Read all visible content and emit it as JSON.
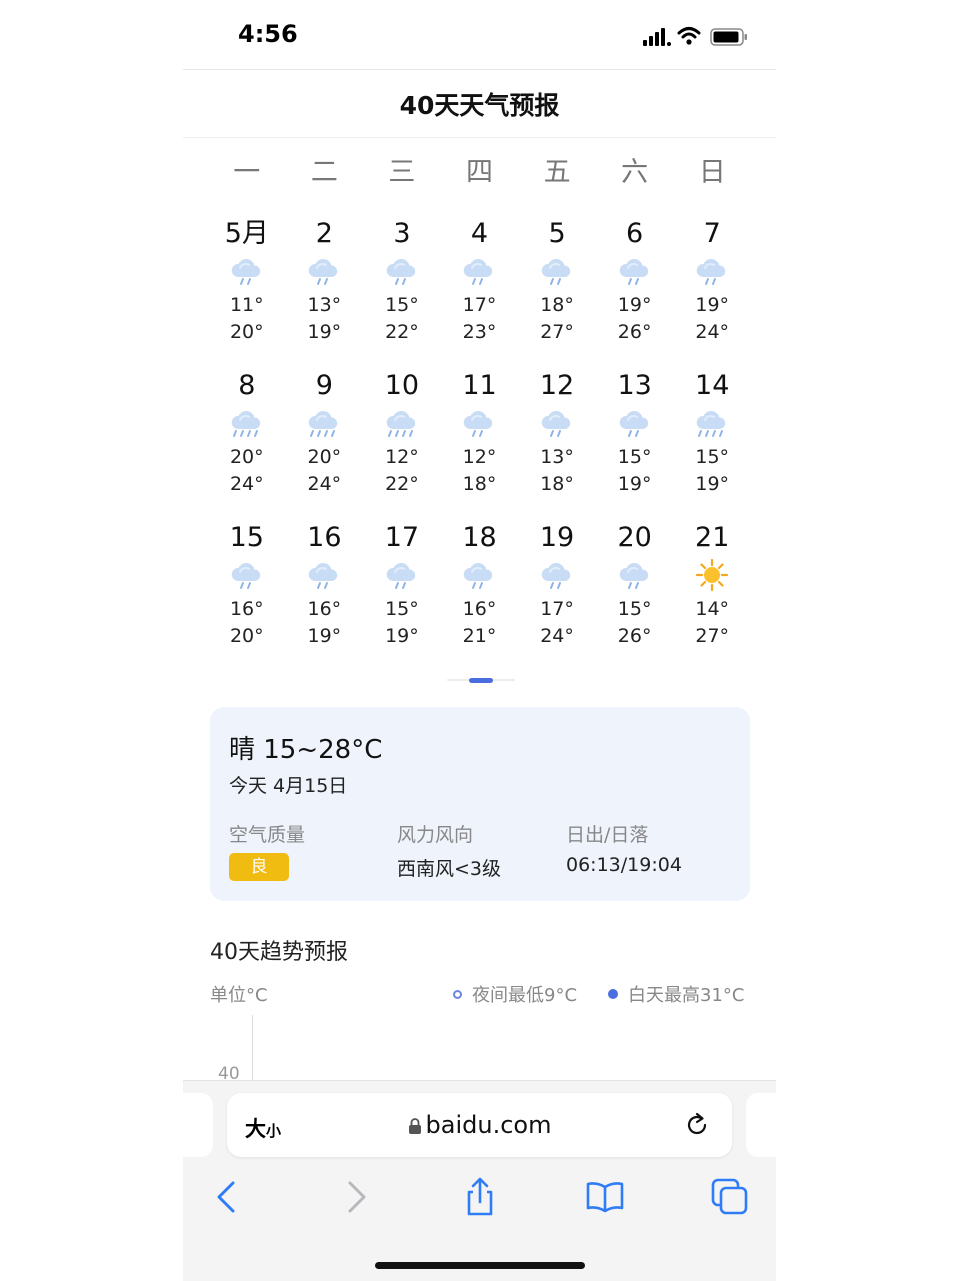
{
  "status": {
    "time": "4:56"
  },
  "page": {
    "title": "40天天气预报"
  },
  "weekdays": [
    "一",
    "二",
    "三",
    "四",
    "五",
    "六",
    "日"
  ],
  "calendar": [
    {
      "day": "5月",
      "icon": "rain-cloud-icon",
      "low": "11°",
      "high": "20°"
    },
    {
      "day": "2",
      "icon": "rain-cloud-icon",
      "low": "13°",
      "high": "19°"
    },
    {
      "day": "3",
      "icon": "rain-cloud-icon",
      "low": "15°",
      "high": "22°"
    },
    {
      "day": "4",
      "icon": "rain-cloud-icon",
      "low": "17°",
      "high": "23°"
    },
    {
      "day": "5",
      "icon": "rain-cloud-icon",
      "low": "18°",
      "high": "27°"
    },
    {
      "day": "6",
      "icon": "rain-cloud-icon",
      "low": "19°",
      "high": "26°"
    },
    {
      "day": "7",
      "icon": "rain-cloud-icon",
      "low": "19°",
      "high": "24°"
    },
    {
      "day": "8",
      "icon": "heavy-rain-cloud-icon",
      "low": "20°",
      "high": "24°"
    },
    {
      "day": "9",
      "icon": "heavy-rain-cloud-icon",
      "low": "20°",
      "high": "24°"
    },
    {
      "day": "10",
      "icon": "heavy-rain-cloud-icon",
      "low": "12°",
      "high": "22°"
    },
    {
      "day": "11",
      "icon": "rain-cloud-icon",
      "low": "12°",
      "high": "18°"
    },
    {
      "day": "12",
      "icon": "rain-cloud-icon",
      "low": "13°",
      "high": "18°"
    },
    {
      "day": "13",
      "icon": "rain-cloud-icon",
      "low": "15°",
      "high": "19°"
    },
    {
      "day": "14",
      "icon": "heavy-rain-cloud-icon",
      "low": "15°",
      "high": "19°"
    },
    {
      "day": "15",
      "icon": "rain-cloud-icon",
      "low": "16°",
      "high": "20°"
    },
    {
      "day": "16",
      "icon": "rain-cloud-icon",
      "low": "16°",
      "high": "19°"
    },
    {
      "day": "17",
      "icon": "rain-cloud-icon",
      "low": "15°",
      "high": "19°"
    },
    {
      "day": "18",
      "icon": "rain-cloud-icon",
      "low": "16°",
      "high": "21°"
    },
    {
      "day": "19",
      "icon": "rain-cloud-icon",
      "low": "17°",
      "high": "24°"
    },
    {
      "day": "20",
      "icon": "rain-cloud-icon",
      "low": "15°",
      "high": "26°"
    },
    {
      "day": "21",
      "icon": "sun-icon",
      "low": "14°",
      "high": "27°"
    }
  ],
  "today": {
    "condition": "晴 15~28°C",
    "date": "今天 4月15日",
    "air_quality_label": "空气质量",
    "air_quality_value": "良",
    "wind_label": "风力风向",
    "wind_value": "西南风<3级",
    "sun_label": "日出/日落",
    "sun_value": "06:13/19:04"
  },
  "trend": {
    "title": "40天趋势预报",
    "unit": "单位°C",
    "legend_night": "夜间最低9°C",
    "legend_day": "白天最高31°C",
    "y_tick": "40"
  },
  "browser": {
    "text_size_big": "大",
    "text_size_small": "小",
    "url": "baidu.com"
  },
  "colors": {
    "accent": "#4a6ee0",
    "card_bg": "#eef3fc",
    "aq_badge": "#f0bc12",
    "safari_blue": "#2f7cf6"
  }
}
